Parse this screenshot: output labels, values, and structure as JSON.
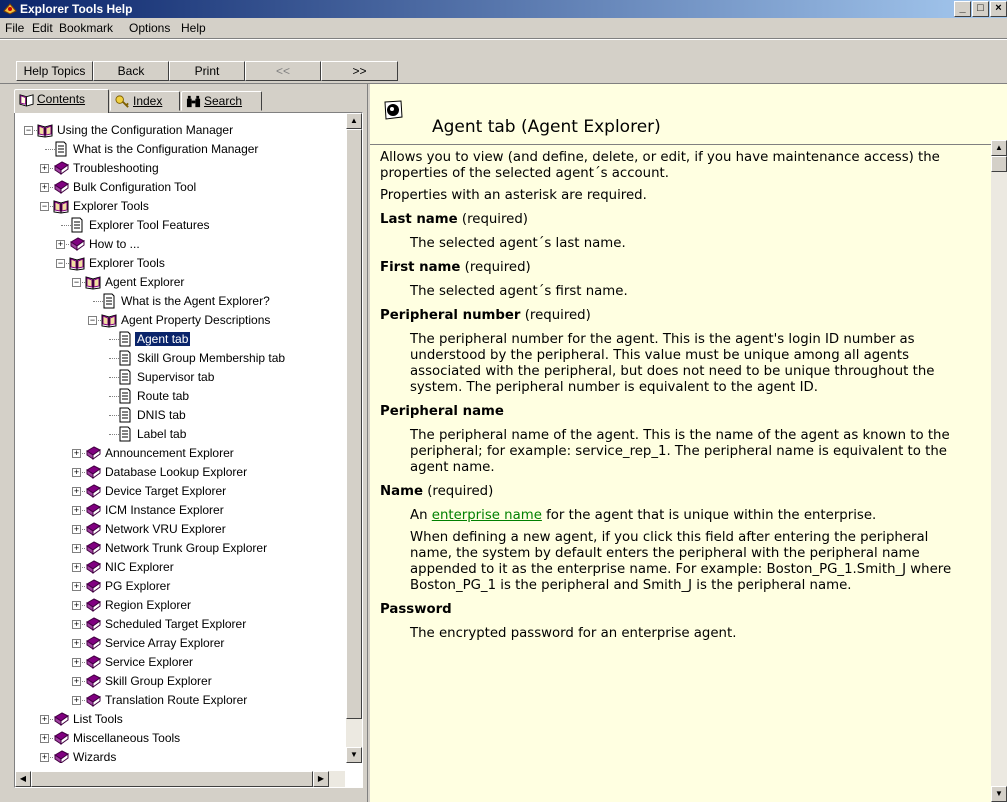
{
  "window": {
    "title": "Explorer Tools Help",
    "controls": [
      "_",
      "□",
      "×"
    ]
  },
  "menu": [
    "File",
    "Edit",
    "Bookmark",
    "Options",
    "Help"
  ],
  "toolbar": {
    "help_topics": "Help Topics",
    "back": "Back",
    "print": "Print",
    "prev": "<<",
    "next": ">>"
  },
  "tabs": {
    "contents": "Contents",
    "index": "Index",
    "search": "Search"
  },
  "tree": [
    {
      "label": "Using the Configuration Manager",
      "level": 0,
      "icon": "open-book",
      "expander": "minus"
    },
    {
      "label": "What is the Configuration Manager",
      "level": 1,
      "icon": "page",
      "expander": ""
    },
    {
      "label": "Troubleshooting",
      "level": 1,
      "icon": "book",
      "expander": "plus"
    },
    {
      "label": "Bulk Configuration Tool",
      "level": 1,
      "icon": "book",
      "expander": "plus"
    },
    {
      "label": "Explorer Tools",
      "level": 1,
      "icon": "open-book",
      "expander": "minus"
    },
    {
      "label": "Explorer Tool Features",
      "level": 2,
      "icon": "page",
      "expander": ""
    },
    {
      "label": "How to ...",
      "level": 2,
      "icon": "book",
      "expander": "plus"
    },
    {
      "label": "Explorer Tools",
      "level": 2,
      "icon": "open-book",
      "expander": "minus"
    },
    {
      "label": "Agent Explorer",
      "level": 3,
      "icon": "open-book",
      "expander": "minus"
    },
    {
      "label": "What is the Agent Explorer?",
      "level": 4,
      "icon": "page",
      "expander": ""
    },
    {
      "label": "Agent Property Descriptions",
      "level": 4,
      "icon": "open-book",
      "expander": "minus"
    },
    {
      "label": "Agent tab",
      "level": 5,
      "icon": "page",
      "expander": "",
      "selected": true
    },
    {
      "label": "Skill Group Membership tab",
      "level": 5,
      "icon": "page",
      "expander": ""
    },
    {
      "label": "Supervisor tab",
      "level": 5,
      "icon": "page",
      "expander": ""
    },
    {
      "label": "Route tab",
      "level": 5,
      "icon": "page",
      "expander": ""
    },
    {
      "label": "DNIS tab",
      "level": 5,
      "icon": "page",
      "expander": ""
    },
    {
      "label": "Label tab",
      "level": 5,
      "icon": "page",
      "expander": ""
    },
    {
      "label": "Announcement Explorer",
      "level": 3,
      "icon": "book",
      "expander": "plus"
    },
    {
      "label": "Database Lookup Explorer",
      "level": 3,
      "icon": "book",
      "expander": "plus"
    },
    {
      "label": "Device Target Explorer",
      "level": 3,
      "icon": "book",
      "expander": "plus"
    },
    {
      "label": "ICM Instance Explorer",
      "level": 3,
      "icon": "book",
      "expander": "plus"
    },
    {
      "label": "Network VRU Explorer",
      "level": 3,
      "icon": "book",
      "expander": "plus"
    },
    {
      "label": "Network Trunk Group Explorer",
      "level": 3,
      "icon": "book",
      "expander": "plus"
    },
    {
      "label": "NIC Explorer",
      "level": 3,
      "icon": "book",
      "expander": "plus"
    },
    {
      "label": "PG Explorer",
      "level": 3,
      "icon": "book",
      "expander": "plus"
    },
    {
      "label": "Region Explorer",
      "level": 3,
      "icon": "book",
      "expander": "plus"
    },
    {
      "label": "Scheduled Target Explorer",
      "level": 3,
      "icon": "book",
      "expander": "plus"
    },
    {
      "label": "Service Array Explorer",
      "level": 3,
      "icon": "book",
      "expander": "plus"
    },
    {
      "label": "Service Explorer",
      "level": 3,
      "icon": "book",
      "expander": "plus"
    },
    {
      "label": "Skill Group Explorer",
      "level": 3,
      "icon": "book",
      "expander": "plus"
    },
    {
      "label": "Translation Route Explorer",
      "level": 3,
      "icon": "book",
      "expander": "plus"
    },
    {
      "label": "List Tools",
      "level": 1,
      "icon": "book",
      "expander": "plus"
    },
    {
      "label": "Miscellaneous Tools",
      "level": 1,
      "icon": "book",
      "expander": "plus"
    },
    {
      "label": "Wizards",
      "level": 1,
      "icon": "book",
      "expander": "plus"
    }
  ],
  "topic": {
    "title": "Agent tab (Agent Explorer)",
    "intro": "Allows you to view (and define, delete, or edit, if you have maintenance access) the properties of the selected agent´s account.",
    "asterisk_note": "Properties with an asterisk are required.",
    "last_name": {
      "name": "Last name",
      "qual": " (required)",
      "desc": "The selected agent´s last name."
    },
    "first_name": {
      "name": "First name",
      "qual": " (required)",
      "desc": "The selected agent´s first name."
    },
    "peripheral_number": {
      "name": "Peripheral number",
      "qual": " (required)",
      "desc": "The peripheral number for the agent. This is the agent's login ID number as understood by the peripheral. This value must be unique among all agents associated with the peripheral, but does not need to be unique throughout the system. The peripheral number is equivalent to the agent ID."
    },
    "peripheral_name": {
      "name": "Peripheral name",
      "desc": "The peripheral name of the agent. This is the name of the agent as known to the peripheral; for example: service_rep_1. The peripheral name is equivalent to the agent name."
    },
    "name": {
      "name": "Name",
      "qual": " (required)",
      "desc_prefix": "An ",
      "link": "enterprise name",
      "desc_suffix": " for the agent that is unique within the enterprise.",
      "desc2": "When defining a new agent, if you click this field after entering the peripheral name, the system by default enters the peripheral with the peripheral name appended to it as the enterprise name. For example: Boston_PG_1.Smith_J where Boston_PG_1 is the peripheral and Smith_J is the peripheral name."
    },
    "password": {
      "name": "Password",
      "desc": "The encrypted password for an enterprise agent."
    }
  }
}
